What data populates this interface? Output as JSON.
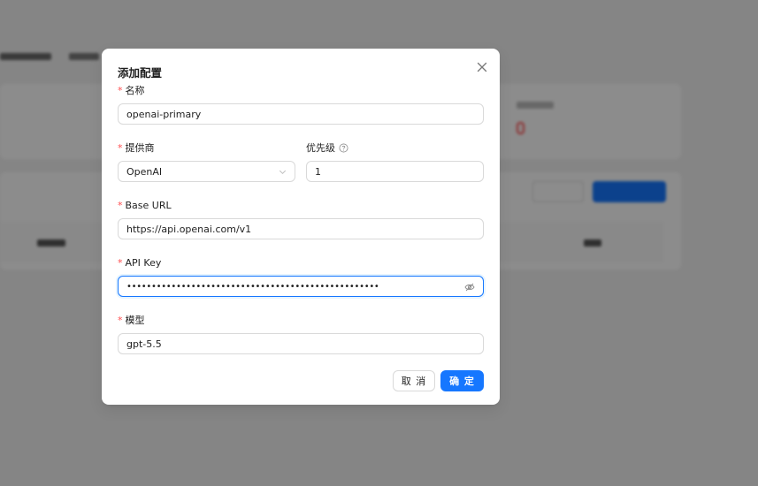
{
  "modal": {
    "title": "添加配置",
    "fields": {
      "name": {
        "label": "名称",
        "required_mark": "*",
        "value": "openai-primary"
      },
      "provider": {
        "label": "提供商",
        "required_mark": "*",
        "value": "OpenAI"
      },
      "priority": {
        "label": "优先级",
        "value": "1"
      },
      "base_url": {
        "label": "Base URL",
        "required_mark": "*",
        "value": "https://api.openai.com/v1"
      },
      "api_key": {
        "label": "API Key",
        "required_mark": "*",
        "value": "•••••••••••••••••••••••••••••••••••••••••••••••••••"
      },
      "model": {
        "label": "模型",
        "required_mark": "*",
        "value": "gpt-5.5"
      }
    },
    "buttons": {
      "cancel": "取 消",
      "ok": "确 定"
    }
  },
  "icons": {
    "close": "close-icon",
    "help": "question-circle-icon",
    "select": "chevron-down-icon",
    "visibility": "eye-invisible-icon"
  },
  "colors": {
    "primary": "#1677ff",
    "required": "#ff4d4f",
    "mask": "rgba(0,0,0,0.45)"
  }
}
